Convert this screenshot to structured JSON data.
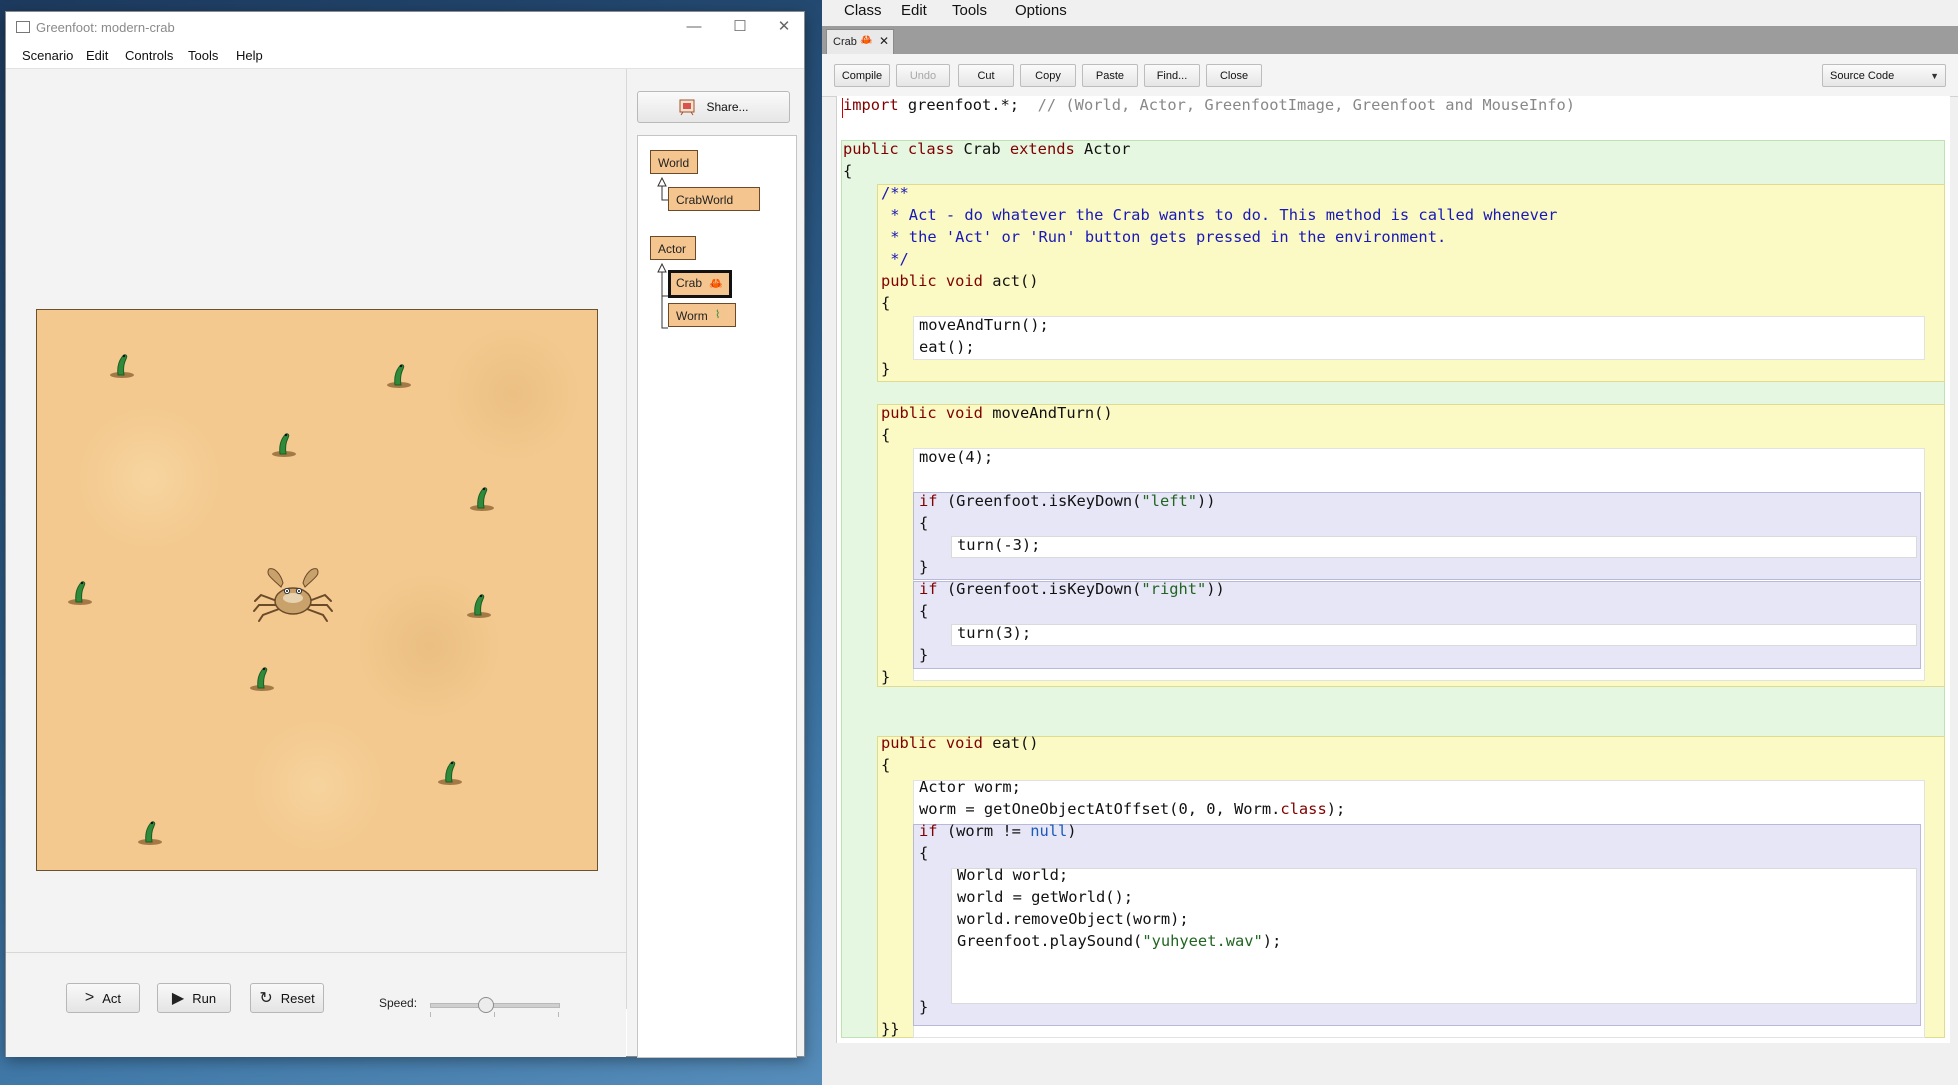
{
  "greenfoot": {
    "title": "Greenfoot: modern-crab",
    "window_controls": {
      "minimize": "—",
      "maximize": "☐",
      "close": "✕"
    },
    "menu": [
      "Scenario",
      "Edit",
      "Controls",
      "Tools",
      "Help"
    ],
    "share_label": "Share...",
    "classes": {
      "world": "World",
      "crabworld": "CrabWorld",
      "actor": "Actor",
      "crab": "Crab",
      "worm": "Worm"
    },
    "controls": {
      "act": "Act",
      "run": "Run",
      "reset": "Reset",
      "speed_label": "Speed:",
      "speed_value": 0.42
    }
  },
  "editor": {
    "menu": [
      "Class",
      "Edit",
      "Tools",
      "Options"
    ],
    "tab_label": "Crab",
    "toolbar": [
      "Compile",
      "Undo",
      "Cut",
      "Copy",
      "Paste",
      "Find...",
      "Close"
    ],
    "view_select": "Source Code",
    "code": {
      "import_kw": "import",
      "import_rest": " greenfoot.*;",
      "import_comment": "  // (World, Actor, GreenfootImage, Greenfoot and MouseInfo)",
      "class_public": "public",
      "class_class": "class",
      "class_name": "Crab",
      "class_extends": "extends",
      "class_super": "Actor",
      "open_brace": "{",
      "close_brace": "}",
      "doc1": "/**",
      "doc2": " * Act - do whatever the Crab wants to do. This method is called whenever",
      "doc3": " * the 'Act' or 'Run' button gets pressed in the environment.",
      "doc4": " */",
      "pub_void": "public void",
      "act_sig": " act()",
      "act_body1": "moveAndTurn();",
      "act_body2": "eat();",
      "mat_sig": " moveAndTurn()",
      "move": "move(4);",
      "if_kw": "if",
      "if_left_a": " (Greenfoot.isKeyDown(",
      "str_left": "\"left\"",
      "if_close": "))",
      "turn_left": "turn(-3);",
      "str_right": "\"right\"",
      "turn_right": "turn(3);",
      "eat_sig": " eat()",
      "eat1": "Actor worm;",
      "eat2a": "worm = getOneObjectAtOffset(0, 0, Worm.",
      "eat2_kw": "class",
      "eat2b": ");",
      "if_worm_a": " (worm != ",
      "null_kw": "null",
      "if_worm_b": ")",
      "w1": "World world;",
      "w2": "world = getWorld();",
      "w3": "world.removeObject(worm);",
      "w4a": "Greenfoot.playSound(",
      "w4_str": "\"yuhyeet.wav\"",
      "w4b": ");",
      "end": "}}"
    }
  }
}
